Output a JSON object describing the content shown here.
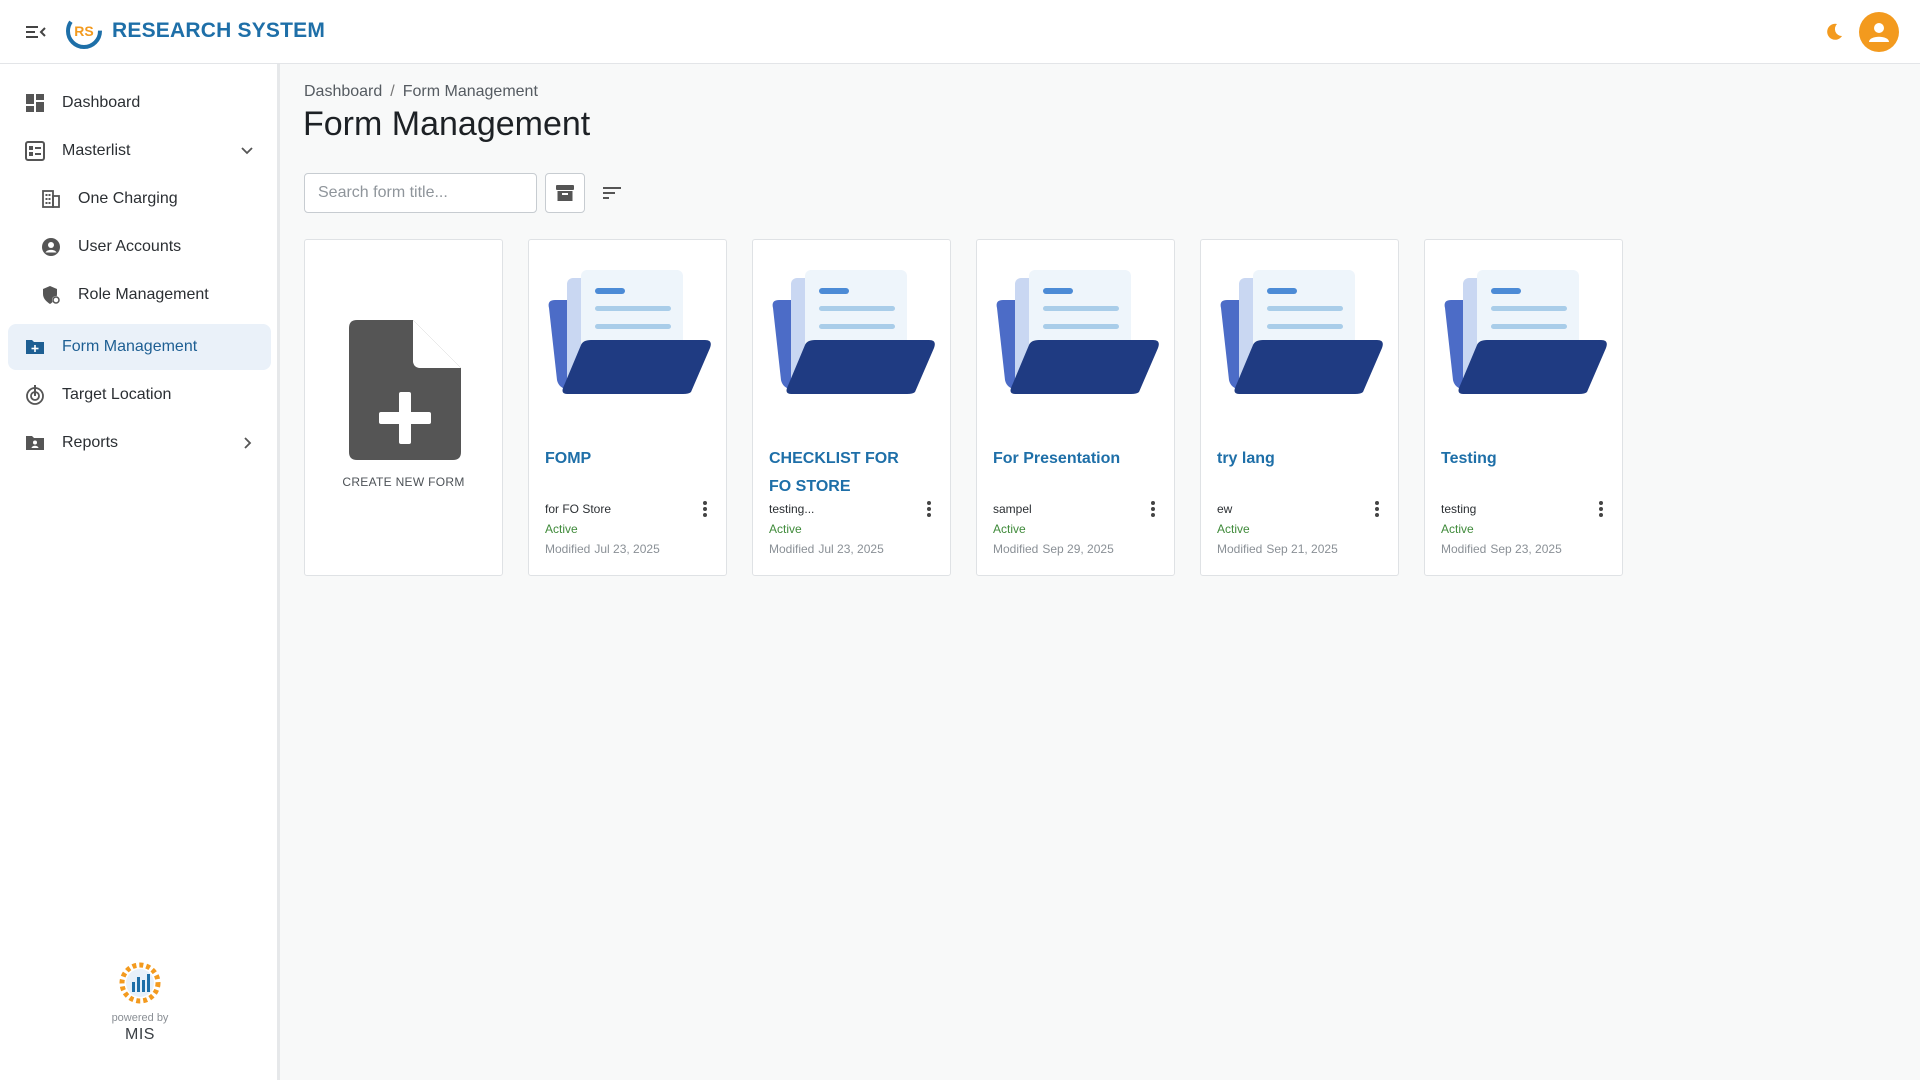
{
  "app": {
    "brand": "RESEARCH SYSTEM",
    "logo_text": "RS",
    "colors": {
      "brand": "#1e6fa8",
      "accent": "#f39a1e",
      "active_bg": "#eaf1f9",
      "status_active": "#3f8a3a",
      "folder_dark": "#1f3b82",
      "folder_mid": "#4c6cc7"
    }
  },
  "header": {
    "menu_icon": "menu-collapse-icon",
    "theme_icon": "moon-icon",
    "avatar_icon": "user-icon"
  },
  "sidebar": {
    "items": [
      {
        "label": "Dashboard",
        "icon": "dashboard-icon"
      },
      {
        "label": "Masterlist",
        "icon": "masterlist-icon",
        "expanded": true
      },
      {
        "label": "One Charging",
        "icon": "building-icon"
      },
      {
        "label": "User Accounts",
        "icon": "account-circle-icon"
      },
      {
        "label": "Role Management",
        "icon": "role-shield-icon"
      },
      {
        "label": "Form Management",
        "icon": "folder-plus-icon",
        "active": true
      },
      {
        "label": "Target Location",
        "icon": "target-icon"
      },
      {
        "label": "Reports",
        "icon": "reports-folder-icon"
      }
    ],
    "footer": {
      "powered_by": "powered by",
      "name": "MIS"
    }
  },
  "main": {
    "breadcrumb": [
      "Dashboard",
      "Form Management"
    ],
    "breadcrumb_sep": "/",
    "title": "Form Management",
    "search": {
      "placeholder": "Search form title...",
      "value": ""
    },
    "archive_icon": "archive-icon",
    "sort_icon": "sort-icon",
    "create_label": "CREATE NEW FORM",
    "modified_label": "Modified",
    "forms": [
      {
        "title": "FOMP",
        "description": "for FO Store",
        "status": "Active",
        "modified": "Jul 23, 2025"
      },
      {
        "title": "CHECKLIST FOR FO STORE",
        "description": "testing...",
        "status": "Active",
        "modified": "Jul 23, 2025"
      },
      {
        "title": "For Presentation",
        "description": "sampel",
        "status": "Active",
        "modified": "Sep 29, 2025"
      },
      {
        "title": "try lang",
        "description": "ew",
        "status": "Active",
        "modified": "Sep 21, 2025"
      },
      {
        "title": "Testing",
        "description": "testing",
        "status": "Active",
        "modified": "Sep 23, 2025"
      }
    ]
  }
}
